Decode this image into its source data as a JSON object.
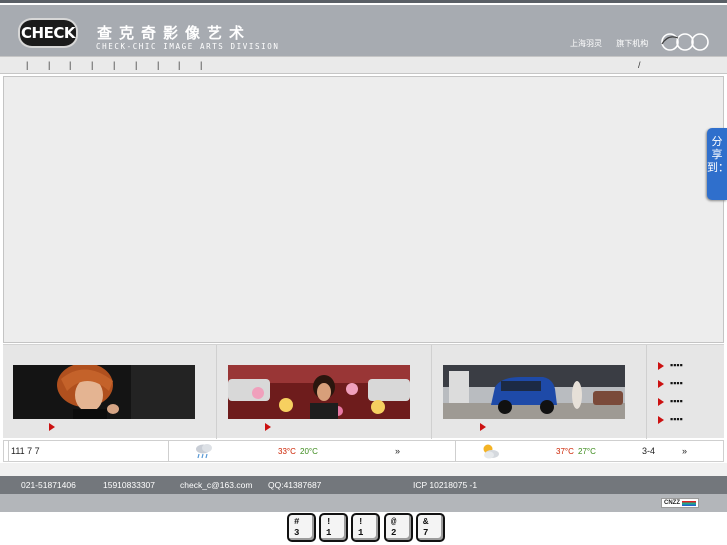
{
  "header": {
    "logo_text": "CHECK",
    "brand_cn": "查克奇影像艺术",
    "brand_en": "CHECK-CHIC IMAGE ARTS DIVISION",
    "links": [
      "上海羽灵",
      "旗下机构"
    ]
  },
  "nav": {
    "separators": [
      "|",
      "|",
      "|",
      "|",
      "|",
      "|",
      "|",
      "|",
      "|",
      "/"
    ]
  },
  "share": {
    "label": "分享到："
  },
  "side_links": [
    "▪▪▪▪",
    "▪▪▪▪",
    "▪▪▪▪",
    "▪▪▪▪"
  ],
  "weather": {
    "date": "111 7 7",
    "city1": {
      "high": "33°C",
      "low": "20°C",
      "more": "»"
    },
    "city2": {
      "high": "37°C",
      "low": "27°C",
      "wind": "3-4",
      "more": "»"
    }
  },
  "footer": {
    "phone1": "021-51871406",
    "phone2": "15910833307",
    "email": "check_c@163.com",
    "qq": "QQ:41387687",
    "icp": "ICP 10218075 -1",
    "counter": "CNZZ"
  },
  "keys": [
    {
      "top": "#",
      "bottom": "3"
    },
    {
      "top": "!",
      "bottom": "1"
    },
    {
      "top": "!",
      "bottom": "1"
    },
    {
      "top": "@",
      "bottom": "2"
    },
    {
      "top": "&",
      "bottom": "7"
    }
  ],
  "colors": {
    "header_bg": "#a7abb1",
    "footer_bg": "#73777c",
    "share_blue": "#2f6fcc",
    "accent_red": "#cc1111",
    "temp_high": "#cc2200",
    "temp_low": "#3a8a1a"
  }
}
